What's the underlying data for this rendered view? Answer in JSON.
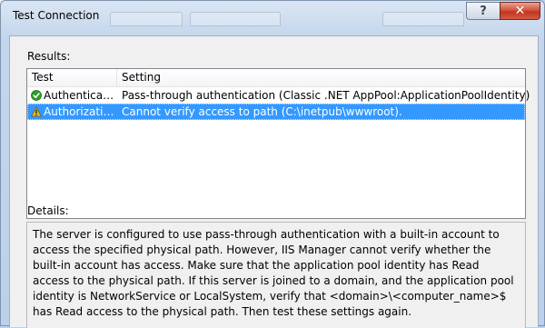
{
  "dialog": {
    "title": "Test Connection",
    "help_label": "?",
    "close_label": "✕"
  },
  "results": {
    "label": "Results:",
    "columns": [
      "Test",
      "Setting"
    ],
    "rows": [
      {
        "test": "Authentication",
        "setting": "Pass-through authentication (Classic .NET AppPool:ApplicationPoolIdentity)",
        "status_icon": "success-check-icon",
        "selected": false
      },
      {
        "test": "Authorization",
        "setting": "Cannot verify access to path (C:\\inetpub\\wwwroot).",
        "status_icon": "warning-icon",
        "selected": true
      }
    ]
  },
  "details": {
    "label": "Details:",
    "text": "The server is configured to use pass-through authentication with a built-in account to access the specified physical path. However, IIS Manager cannot verify whether the built-in account has access. Make sure that the application pool identity has Read access to the physical path. If this server is joined to a domain, and the application pool identity is NetworkService or LocalSystem, verify that <domain>\\<computer_name>$ has Read access to the physical path. Then test these settings again."
  },
  "colors": {
    "selection": "#3399ff",
    "success": "#2e9e2e",
    "warning": "#e8b923"
  }
}
